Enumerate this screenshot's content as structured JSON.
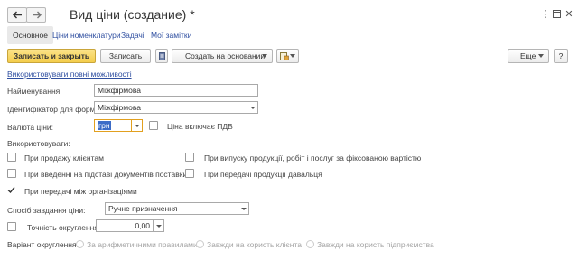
{
  "window": {
    "title": "Вид ціни (создание) *",
    "back_icon": "arrow-left-icon",
    "forward_icon": "arrow-right-icon",
    "more_icon": "vertical-dots-icon",
    "maximize_icon": "window-icon",
    "close_icon": "close-icon"
  },
  "tabs": [
    {
      "label": "Основное",
      "active": true
    },
    {
      "label": "Ціни номенклатури",
      "active": false
    },
    {
      "label": "Задачі",
      "active": false
    },
    {
      "label": "Мої замітки",
      "active": false
    }
  ],
  "toolbar": {
    "save_close_label": "Записать и закрыть",
    "save_label": "Записать",
    "create_based_label": "Создать на основании",
    "more_label": "Еще",
    "help_label": "?"
  },
  "use_full_link": "Використовувати повні можливості",
  "form": {
    "name_label": "Найменування:",
    "name_value": "Міжфірмова",
    "identifier_label": "Ідентифікатор для формул:",
    "identifier_value": "Міжфірмова",
    "currency_label": "Валюта ціни:",
    "currency_value": "грн",
    "vat_label": "Ціна включає ПДВ",
    "vat_checked": false,
    "used_label": "Використовувати:",
    "options": [
      {
        "label": "При продажу клієнтам",
        "checked": false
      },
      {
        "label": "При випуску продукції, робіт і послуг за фіксованою вартістю",
        "checked": false
      },
      {
        "label": "При введенні на підставі документів поставки",
        "checked": false
      },
      {
        "label": "При передачі продукції давальця",
        "checked": false
      },
      {
        "label": "При передачі між організаціями",
        "checked": true
      }
    ],
    "price_method_label": "Спосіб завдання ціни:",
    "price_method_value": "Ручне призначення",
    "rounding_accuracy_label": "Точність округлення:",
    "rounding_accuracy_value": "0,00",
    "rounding_accuracy_checked": false,
    "rounding_variant_label": "Варіант округлення:",
    "rounding_variants": [
      "За арифметичними правилами",
      "Завжди на користь клієнта",
      "Завжди на користь підприємства"
    ]
  }
}
